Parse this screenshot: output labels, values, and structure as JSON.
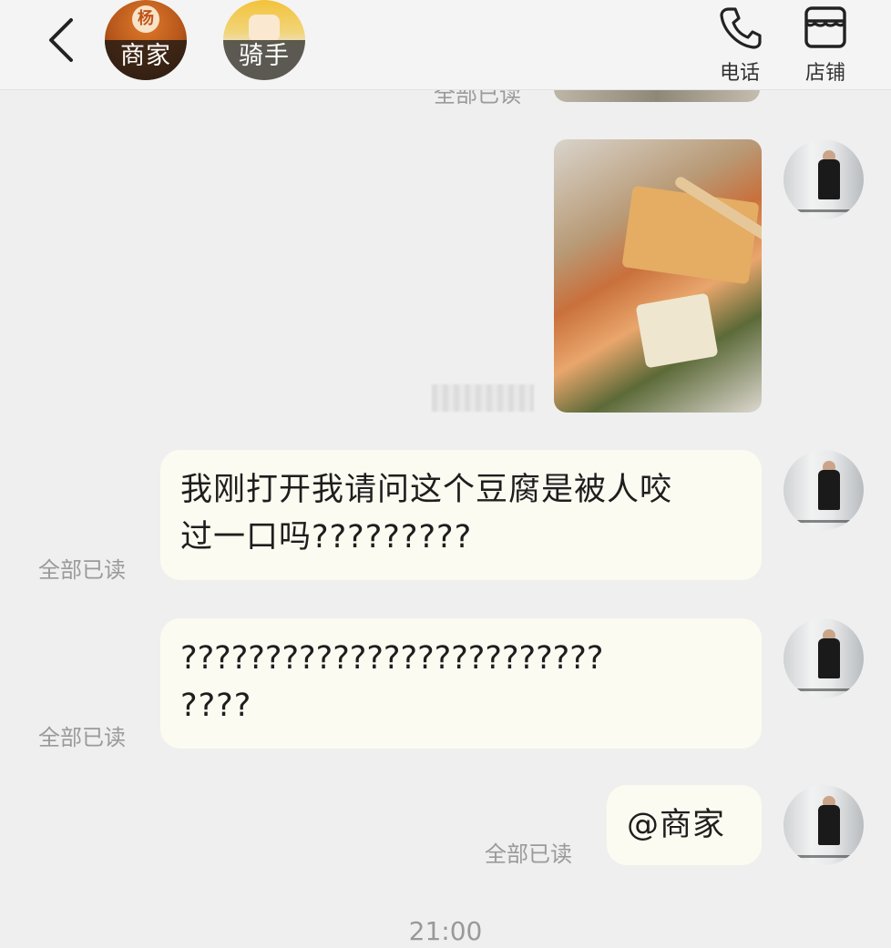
{
  "header": {
    "merchant_chip": "商家",
    "rider_chip": "骑手",
    "phone_label": "电话",
    "store_label": "店铺"
  },
  "messages": [
    {
      "type": "image",
      "read_status": ""
    },
    {
      "type": "text",
      "text_line1": "我刚打开我请问这个豆腐是被人咬",
      "text_line2": "过一口吗?????????",
      "read_status": "全部已读"
    },
    {
      "type": "text",
      "text_line1": "?????????????????????????",
      "text_line2": "????",
      "read_status": "全部已读"
    },
    {
      "type": "text",
      "text_line1": "@商家",
      "read_status": "全部已读"
    }
  ],
  "top_partial_read_status": "全部已读",
  "timestamp": "21:00",
  "colors": {
    "background": "#efefef",
    "bubble": "#fcfbf1",
    "read_text": "#9a9a9a"
  }
}
